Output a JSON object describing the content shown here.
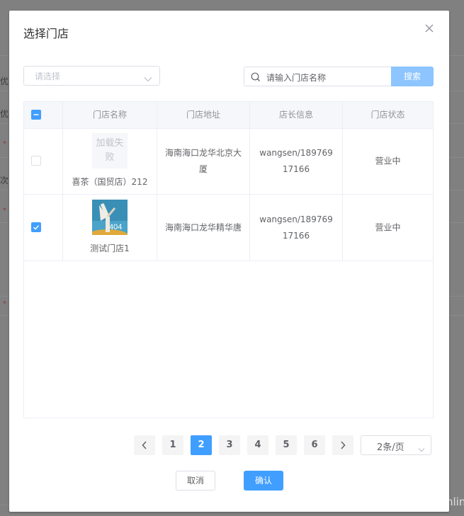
{
  "background": {
    "labels": [
      "优",
      "优",
      "次"
    ],
    "required_mark": "*"
  },
  "dialog": {
    "title": "选择门店",
    "close_icon": "close-icon"
  },
  "filter": {
    "select_placeholder": "请选择",
    "search_placeholder": "请输入门店名称",
    "search_button": "搜索"
  },
  "table": {
    "columns": [
      "门店名称",
      "门店地址",
      "店长信息",
      "门店状态"
    ],
    "header_checkbox": "indeterminate",
    "rows": [
      {
        "checked": false,
        "image_state": "加载失败",
        "image_fail_text": "加载失\n败",
        "name": "喜茶（国贸店）212",
        "address": "海南海口龙华北京大厦",
        "manager": "wangsen/18976917166",
        "status": "营业中"
      },
      {
        "checked": true,
        "image_state": "404",
        "image_text": "404",
        "name": "测试门店1",
        "address": "海南海口龙华精华唐",
        "manager": "wangsen/18976917166",
        "status": "营业中"
      }
    ]
  },
  "pagination": {
    "prev_icon": "chevron-left-icon",
    "next_icon": "chevron-right-icon",
    "pages": [
      "1",
      "2",
      "3",
      "4",
      "5",
      "6"
    ],
    "current_page": "2",
    "page_size": "2条/页"
  },
  "footer": {
    "cancel": "取消",
    "confirm": "确认"
  },
  "watermark": "https://blog.csdn.net/wangsenling",
  "colors": {
    "primary": "#409eff",
    "search_button": "#8cc5ff",
    "overlay": "#808080"
  }
}
